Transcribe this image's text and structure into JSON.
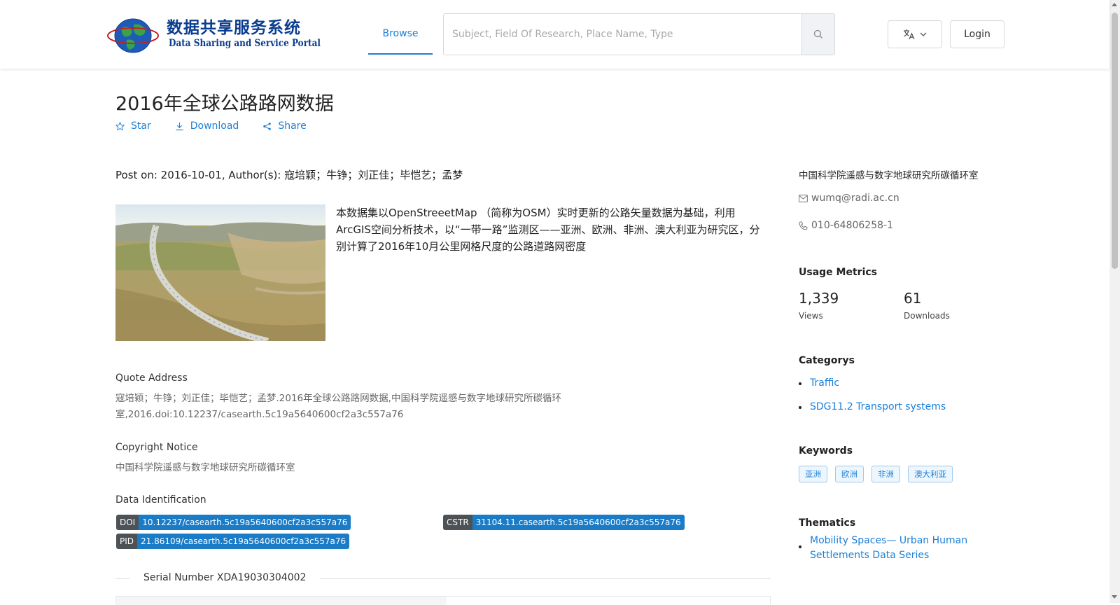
{
  "header": {
    "logo_cn": "数据共享服务系统",
    "logo_en": "Data Sharing and Service Portal",
    "nav_browse": "Browse",
    "search_placeholder": "Subject, Field Of Research, Place Name, Type",
    "login": "Login"
  },
  "dataset": {
    "title": "2016年全球公路路网数据",
    "actions": {
      "star": "Star",
      "download": "Download",
      "share": "Share"
    },
    "post_line": "Post on: 2016-10-01, Author(s): 寇培颖；牛铮；刘正佳；毕恺艺；孟梦",
    "abstract": "本数据集以OpenStreeetMap （简称为OSM）实时更新的公路矢量数据为基础，利用ArcGIS空间分析技术，以“一带一路”监测区——亚洲、欧洲、非洲、澳大利亚为研究区，分别计算了2016年10月公里网格尺度的公路道路网密度",
    "quote_heading": "Quote Address",
    "quote_text": "寇培颖；牛铮；刘正佳；毕恺艺；孟梦.2016年全球公路路网数据,中国科学院遥感与数字地球研究所碳循环室,2016.doi:10.12237/casearth.5c19a5640600cf2a3c557a76",
    "copyright_heading": "Copyright Notice",
    "copyright_text": "中国科学院遥感与数字地球研究所碳循环室",
    "identification_heading": "Data Identification",
    "ids": {
      "doi_label": "DOI",
      "doi_value": "10.12237/casearth.5c19a5640600cf2a3c557a76",
      "cstr_label": "CSTR",
      "cstr_value": "31104.11.casearth.5c19a5640600cf2a3c557a76",
      "pid_label": "PID",
      "pid_value": "21.86109/casearth.5c19a5640600cf2a3c557a76"
    },
    "serial_number": "Serial Number XDA19030304002"
  },
  "sidebar": {
    "organization": "中国科学院遥感与数字地球研究所碳循环室",
    "email": "wumq@radi.ac.cn",
    "phone": "010-64806258-1",
    "usage_heading": "Usage Metrics",
    "views_value": "1,339",
    "views_label": "Views",
    "downloads_value": "61",
    "downloads_label": "Downloads",
    "categories_heading": "Categorys",
    "categories": [
      "Traffic",
      "SDG11.2 Transport systems"
    ],
    "keywords_heading": "Keywords",
    "keywords": [
      "亚洲",
      "欧洲",
      "非洲",
      "澳大利亚"
    ],
    "thematics_heading": "Thematics",
    "thematics": [
      "Mobility Spaces— Urban Human Settlements Data Series"
    ]
  },
  "icons": {
    "search": "search-icon",
    "translate": "translate-icon",
    "chevron": "chevron-down-icon",
    "star": "star-icon",
    "download": "download-icon",
    "share": "share-icon",
    "mail": "mail-icon",
    "phone": "phone-icon"
  },
  "colors": {
    "link": "#1b7fd8",
    "badge_key": "#4d5256",
    "badge_value": "#1a7bc7"
  }
}
